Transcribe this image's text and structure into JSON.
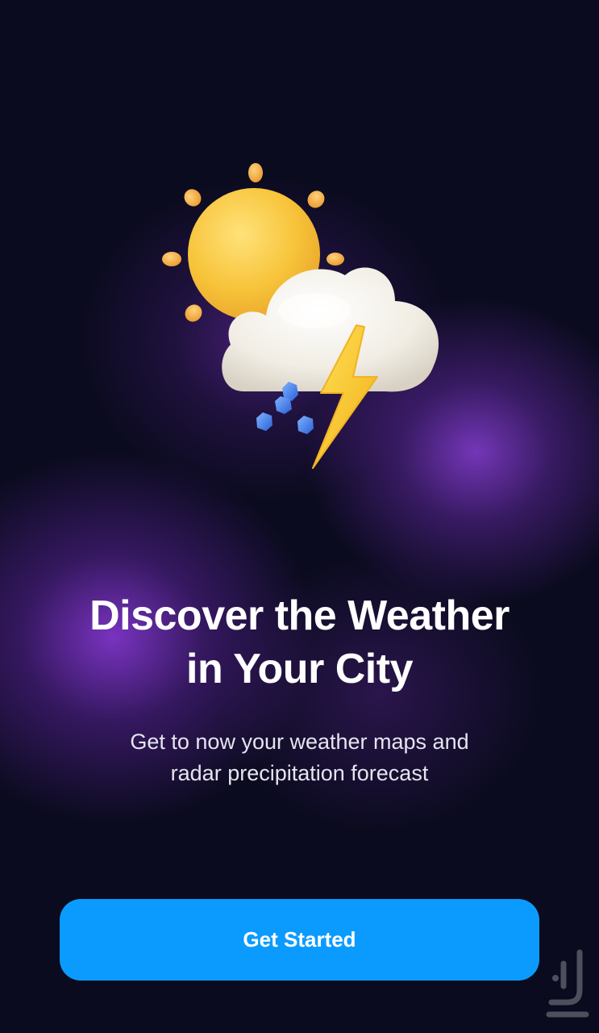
{
  "illustration": {
    "icon": "sun-cloud-thunderstorm-icon",
    "colors": {
      "sun": "#f7c43a",
      "sun_rays": "#f2a93b",
      "cloud": "#f4f1ea",
      "bolt": "#f8c62a",
      "hail": "#3f7bea"
    }
  },
  "onboarding": {
    "title_line1": "Discover the Weather",
    "title_line2": "in Your City",
    "subtitle_line1": "Get to now your weather maps and",
    "subtitle_line2": "radar precipitation forecast"
  },
  "cta": {
    "label": "Get Started",
    "color": "#0b9bff"
  },
  "watermark": {
    "icon": "store-logo-watermark"
  }
}
